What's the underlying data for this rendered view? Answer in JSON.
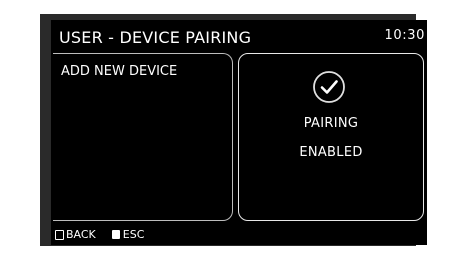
{
  "header": {
    "title": "USER - DEVICE PAIRING",
    "time": "10:30"
  },
  "left_panel": {
    "label": "ADD NEW DEVICE"
  },
  "right_panel": {
    "icon": "check-circle-icon",
    "line1": "PAIRING",
    "line2": "ENABLED"
  },
  "footer": {
    "back_label": "BACK",
    "esc_label": "ESC"
  }
}
